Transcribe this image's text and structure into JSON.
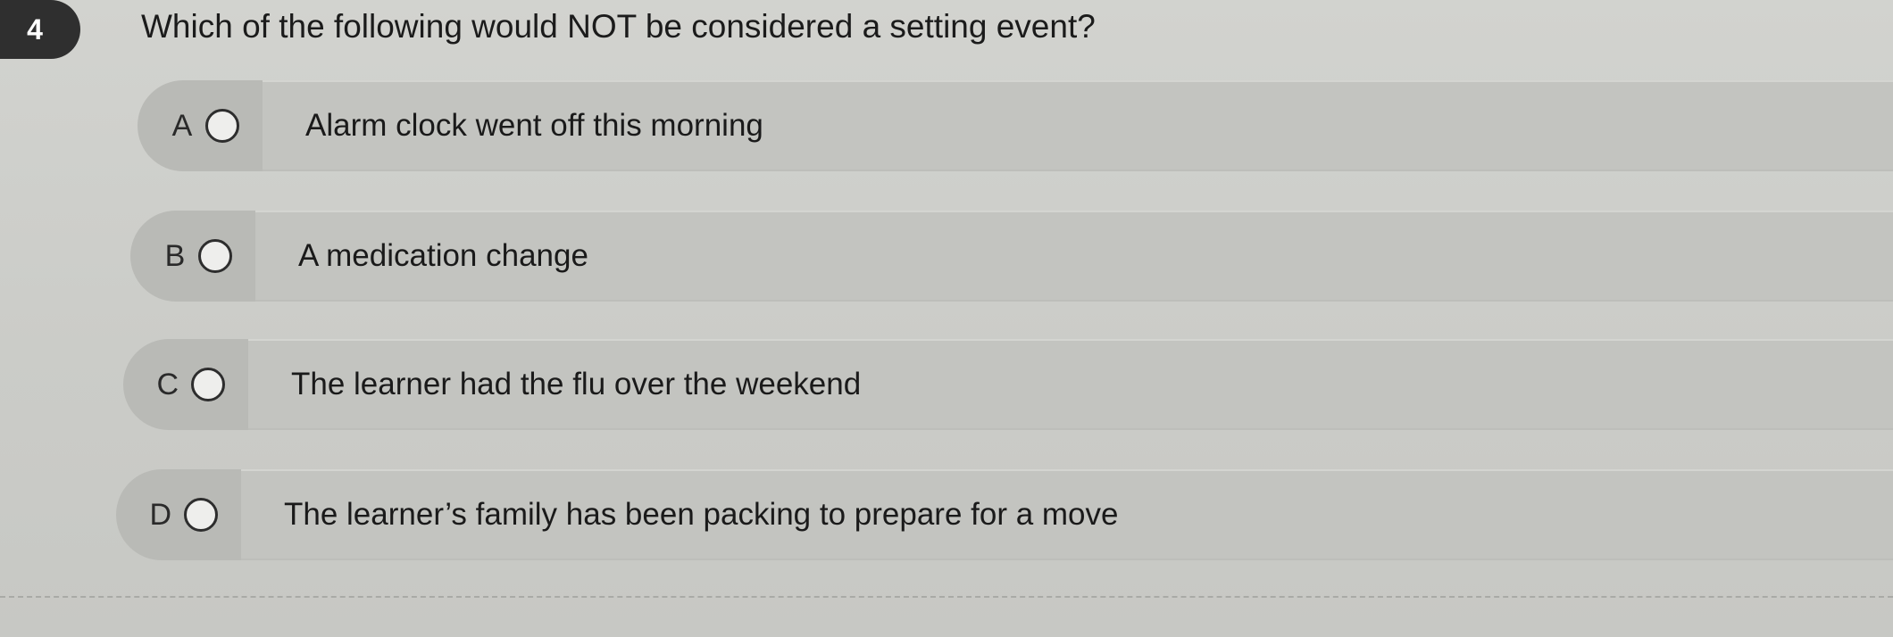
{
  "question": {
    "number": "4",
    "text": "Which of the following would NOT be considered a setting event?"
  },
  "options": [
    {
      "letter": "A",
      "text": "Alarm clock went off this morning"
    },
    {
      "letter": "B",
      "text": "A medication change"
    },
    {
      "letter": "C",
      "text": "The learner had the flu over the weekend"
    },
    {
      "letter": "D",
      "text": "The learner’s family has been packing to prepare for a move"
    }
  ],
  "colors": {
    "page_background": "#cfd0cc",
    "number_badge": "#2f2f2f",
    "option_left_panel": "#b9bab6",
    "option_right_panel": "#c3c4c0"
  },
  "icons": {
    "radio": "radio-button-unselected-icon"
  }
}
